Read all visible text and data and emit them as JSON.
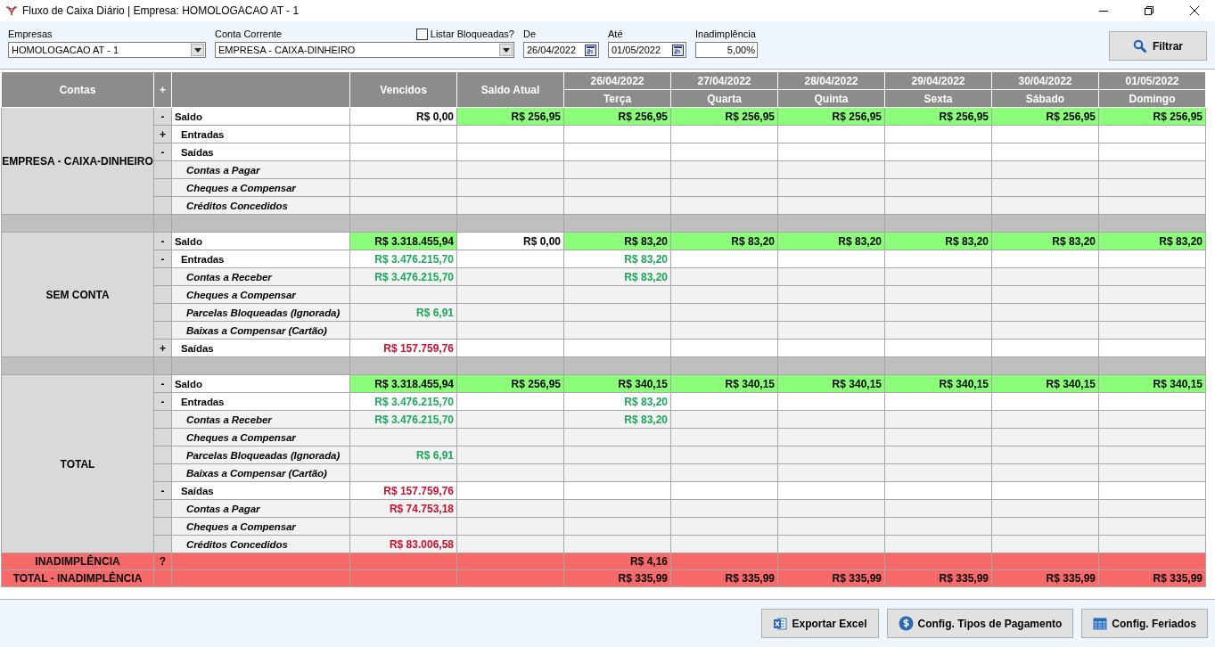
{
  "window": {
    "title": "Fluxo de Caixa Diário | Empresa: HOMOLOGACAO AT - 1"
  },
  "filters": {
    "empresas": {
      "label": "Empresas",
      "value": "HOMOLOGACAO AT - 1"
    },
    "conta_corrente": {
      "label": "Conta Corrente",
      "value": "EMPRESA - CAIXA-DINHEIRO"
    },
    "listar_bloqueadas": {
      "label": "Listar Bloqueadas?",
      "checked": false
    },
    "de": {
      "label": "De",
      "value": "26/04/2022"
    },
    "ate": {
      "label": "Até",
      "value": "01/05/2022"
    },
    "inadimplencia": {
      "label": "Inadimplência",
      "value": "5,00%"
    },
    "filter_button": "Filtrar"
  },
  "table": {
    "columns": {
      "contas": "Contas",
      "toggle": "+",
      "vencidos": "Vencidos",
      "saldo_atual": "Saldo Atual"
    },
    "days": [
      {
        "date": "26/04/2022",
        "weekday": "Terça"
      },
      {
        "date": "27/04/2022",
        "weekday": "Quarta"
      },
      {
        "date": "28/04/2022",
        "weekday": "Quinta"
      },
      {
        "date": "29/04/2022",
        "weekday": "Sexta"
      },
      {
        "date": "30/04/2022",
        "weekday": "Sábado"
      },
      {
        "date": "01/05/2022",
        "weekday": "Domingo"
      }
    ],
    "groups": [
      {
        "name": "EMPRESA - CAIXA-DINHEIRO",
        "rows": [
          {
            "toggle": "-",
            "label": "Saldo",
            "kind": "balance",
            "cells": [
              {
                "text": "R$ 0,00",
                "highlighted": false
              },
              {
                "text": "R$ 256,95",
                "highlighted": true
              },
              {
                "text": "R$ 256,95",
                "highlighted": true
              },
              {
                "text": "R$ 256,95",
                "highlighted": true
              },
              {
                "text": "R$ 256,95",
                "highlighted": true
              },
              {
                "text": "R$ 256,95",
                "highlighted": true
              },
              {
                "text": "R$ 256,95",
                "highlighted": true
              },
              {
                "text": "R$ 256,95",
                "highlighted": true
              }
            ]
          },
          {
            "toggle": "+",
            "label": "Entradas",
            "kind": "flow",
            "cells": [
              {},
              {},
              {},
              {},
              {},
              {},
              {},
              {}
            ]
          },
          {
            "toggle": "-",
            "label": "Saídas",
            "kind": "flow",
            "cells": [
              {},
              {},
              {},
              {},
              {},
              {},
              {},
              {}
            ]
          },
          {
            "label": "Contas a Pagar",
            "kind": "item",
            "cells": [
              {},
              {},
              {},
              {},
              {},
              {},
              {},
              {}
            ]
          },
          {
            "label": "Cheques a Compensar",
            "kind": "item",
            "cells": [
              {},
              {},
              {},
              {},
              {},
              {},
              {},
              {}
            ]
          },
          {
            "label": "Créditos Concedidos",
            "kind": "item",
            "cells": [
              {},
              {},
              {},
              {},
              {},
              {},
              {},
              {}
            ]
          }
        ]
      },
      {
        "name": "SEM CONTA",
        "rows": [
          {
            "toggle": "-",
            "label": "Saldo",
            "kind": "balance",
            "cells": [
              {
                "text": "R$ 3.318.455,94",
                "highlighted": true
              },
              {
                "text": "R$ 0,00",
                "highlighted": false
              },
              {
                "text": "R$ 83,20",
                "highlighted": true
              },
              {
                "text": "R$ 83,20",
                "highlighted": true
              },
              {
                "text": "R$ 83,20",
                "highlighted": true
              },
              {
                "text": "R$ 83,20",
                "highlighted": true
              },
              {
                "text": "R$ 83,20",
                "highlighted": true
              },
              {
                "text": "R$ 83,20",
                "highlighted": true
              }
            ]
          },
          {
            "toggle": "-",
            "label": "Entradas",
            "kind": "flow",
            "cells": [
              {
                "text": "R$ 3.476.215,70",
                "color": "#1aa85a",
                "highlighted": false
              },
              {},
              {
                "text": "R$ 83,20",
                "color": "#1aa85a",
                "highlighted": false
              },
              {},
              {},
              {},
              {},
              {}
            ]
          },
          {
            "label": "Contas a Receber",
            "kind": "item",
            "cells": [
              {
                "text": "R$ 3.476.215,70",
                "color": "#1aa85a",
                "highlighted": false
              },
              {},
              {
                "text": "R$ 83,20",
                "color": "#1aa85a",
                "highlighted": false
              },
              {},
              {},
              {},
              {},
              {}
            ]
          },
          {
            "label": "Cheques a Compensar",
            "kind": "item",
            "cells": [
              {},
              {},
              {},
              {},
              {},
              {},
              {},
              {}
            ]
          },
          {
            "label": "Parcelas Bloqueadas (Ignorada)",
            "kind": "item",
            "cells": [
              {
                "text": "R$ 6,91",
                "color": "#1aa85a",
                "highlighted": false
              },
              {},
              {},
              {},
              {},
              {},
              {},
              {}
            ]
          },
          {
            "label": "Baixas a Compensar (Cartão)",
            "kind": "item",
            "cells": [
              {},
              {},
              {},
              {},
              {},
              {},
              {},
              {}
            ]
          },
          {
            "toggle": "+",
            "label": "Saídas",
            "kind": "flow",
            "cells": [
              {
                "text": "R$ 157.759,76",
                "color": "#c8102e",
                "highlighted": false
              },
              {},
              {},
              {},
              {},
              {},
              {},
              {}
            ]
          }
        ]
      },
      {
        "name": "TOTAL",
        "rows": [
          {
            "toggle": "-",
            "label": "Saldo",
            "kind": "balance",
            "cells": [
              {
                "text": "R$ 3.318.455,94",
                "highlighted": true
              },
              {
                "text": "R$ 256,95",
                "highlighted": true
              },
              {
                "text": "R$ 340,15",
                "highlighted": true
              },
              {
                "text": "R$ 340,15",
                "highlighted": true
              },
              {
                "text": "R$ 340,15",
                "highlighted": true
              },
              {
                "text": "R$ 340,15",
                "highlighted": true
              },
              {
                "text": "R$ 340,15",
                "highlighted": true
              },
              {
                "text": "R$ 340,15",
                "highlighted": true
              }
            ]
          },
          {
            "toggle": "-",
            "label": "Entradas",
            "kind": "flow",
            "cells": [
              {
                "text": "R$ 3.476.215,70",
                "color": "#1aa85a",
                "highlighted": false
              },
              {},
              {
                "text": "R$ 83,20",
                "color": "#1aa85a",
                "highlighted": false
              },
              {},
              {},
              {},
              {},
              {}
            ]
          },
          {
            "label": "Contas a Receber",
            "kind": "item",
            "cells": [
              {
                "text": "R$ 3.476.215,70",
                "color": "#1aa85a",
                "highlighted": false
              },
              {},
              {
                "text": "R$ 83,20",
                "color": "#1aa85a",
                "highlighted": false
              },
              {},
              {},
              {},
              {},
              {}
            ]
          },
          {
            "label": "Cheques a Compensar",
            "kind": "item",
            "cells": [
              {},
              {},
              {},
              {},
              {},
              {},
              {},
              {}
            ]
          },
          {
            "label": "Parcelas Bloqueadas (Ignorada)",
            "kind": "item",
            "cells": [
              {
                "text": "R$ 6,91",
                "color": "#1aa85a",
                "highlighted": false
              },
              {},
              {},
              {},
              {},
              {},
              {},
              {}
            ]
          },
          {
            "label": "Baixas a Compensar (Cartão)",
            "kind": "item",
            "cells": [
              {},
              {},
              {},
              {},
              {},
              {},
              {},
              {}
            ]
          },
          {
            "toggle": "-",
            "label": "Saídas",
            "kind": "flow",
            "cells": [
              {
                "text": "R$ 157.759,76",
                "color": "#c8102e",
                "highlighted": false
              },
              {},
              {},
              {},
              {},
              {},
              {},
              {}
            ]
          },
          {
            "label": "Contas a Pagar",
            "kind": "item",
            "cells": [
              {
                "text": "R$ 74.753,18",
                "color": "#c8102e",
                "highlighted": false
              },
              {},
              {},
              {},
              {},
              {},
              {},
              {}
            ]
          },
          {
            "label": "Cheques a Compensar",
            "kind": "item",
            "cells": [
              {},
              {},
              {},
              {},
              {},
              {},
              {},
              {}
            ]
          },
          {
            "label": "Créditos Concedidos",
            "kind": "item",
            "cells": [
              {
                "text": "R$ 83.006,58",
                "color": "#c8102e",
                "highlighted": false
              },
              {},
              {},
              {},
              {},
              {},
              {},
              {}
            ]
          }
        ]
      }
    ],
    "footer_rows": [
      {
        "label": "INADIMPLÊNCIA",
        "toggle": "?",
        "cells": [
          {},
          {},
          {
            "text": "R$ 4,16"
          },
          {},
          {},
          {},
          {},
          {}
        ]
      },
      {
        "label": "TOTAL - INADIMPLÊNCIA",
        "cells": [
          {},
          {},
          {
            "text": "R$ 335,99"
          },
          {
            "text": "R$ 335,99"
          },
          {
            "text": "R$ 335,99"
          },
          {
            "text": "R$ 335,99"
          },
          {
            "text": "R$ 335,99"
          },
          {
            "text": "R$ 335,99"
          }
        ]
      }
    ]
  },
  "actions": [
    {
      "kind": "excel",
      "label": "Exportar Excel"
    },
    {
      "kind": "money",
      "label": "Config. Tipos de Pagamento"
    },
    {
      "kind": "grid",
      "label": "Config. Feriados"
    }
  ]
}
